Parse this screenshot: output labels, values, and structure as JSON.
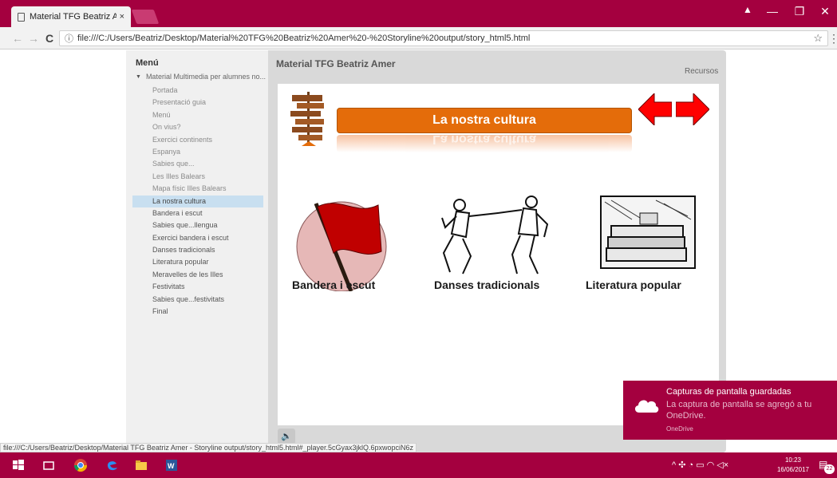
{
  "browser": {
    "tab_title": "Material TFG Beatriz Ame",
    "tab_close": "×",
    "url": "file:///C:/Users/Beatriz/Desktop/Material%20TFG%20Beatriz%20Amer%20-%20Storyline%20output/story_html5.html",
    "nav": {
      "back": "←",
      "forward": "→",
      "reload": "C"
    },
    "info": "ⓘ",
    "star": "☆",
    "dots": "⋮",
    "window_controls": {
      "profile": "▲",
      "minimize": "—",
      "restore": "❐",
      "close": "✕"
    }
  },
  "sidebar": {
    "title": "Menú",
    "root": "Material Multimedia per alumnes no...",
    "items": [
      {
        "label": "Portada",
        "state": "visited"
      },
      {
        "label": "Presentació guia",
        "state": "visited"
      },
      {
        "label": "Menú",
        "state": "visited"
      },
      {
        "label": "On vius?",
        "state": "visited"
      },
      {
        "label": "Exercici continents",
        "state": "visited"
      },
      {
        "label": "Espanya",
        "state": "visited"
      },
      {
        "label": "Sabies que...",
        "state": "visited"
      },
      {
        "label": "Les Illes Balears",
        "state": "visited"
      },
      {
        "label": "Mapa físic Illes Balears",
        "state": "visited"
      },
      {
        "label": "La nostra cultura",
        "state": "active"
      },
      {
        "label": "Bandera i escut",
        "state": "normal"
      },
      {
        "label": "Sabies que...llengua",
        "state": "normal"
      },
      {
        "label": "Exercici bandera i escut",
        "state": "normal"
      },
      {
        "label": "Danses tradicionals",
        "state": "normal"
      },
      {
        "label": "Literatura popular",
        "state": "normal"
      },
      {
        "label": "Meravelles de les Illes",
        "state": "normal"
      },
      {
        "label": "Festivitats",
        "state": "normal"
      },
      {
        "label": "Sabies que...festivitats",
        "state": "normal"
      },
      {
        "label": "Final",
        "state": "normal"
      }
    ]
  },
  "player": {
    "title": "Material TFG Beatriz Amer",
    "resources": "Recursos",
    "speaker": "🔈"
  },
  "slide": {
    "title": "La nostra cultura",
    "tiles": [
      {
        "label": "Bandera i escut",
        "icon": "flag-icon"
      },
      {
        "label": "Danses tradicionals",
        "icon": "dancers-icon"
      },
      {
        "label": "Literatura popular",
        "icon": "books-icon"
      }
    ],
    "colors": {
      "title_bar": "#e46c0a",
      "arrows": "#ff0000"
    }
  },
  "status": {
    "text": "file:///C:/Users/Beatriz/Desktop/Material TFG Beatriz Amer - Storyline output/story_html5.html#_player.5cGyax3jklQ.6pxwopciN6z"
  },
  "toast": {
    "title": "Capturas de pantalla guardadas",
    "body": "La captura de pantalla se agregó a tu OneDrive.",
    "source": "OneDrive"
  },
  "taskbar": {
    "tray": "^ ✣ ◔ ▭ ◠ ◁×",
    "time": "10:23",
    "date": "16/06/2017",
    "notifications": "22"
  },
  "theme": {
    "accent": "#a4003f"
  }
}
